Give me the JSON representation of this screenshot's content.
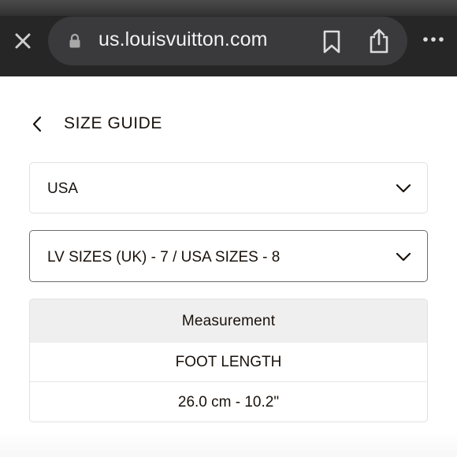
{
  "browser": {
    "url": "us.louisvuitton.com",
    "icons": [
      "close-icon",
      "lock-icon",
      "bookmark-icon",
      "share-icon",
      "more-icon"
    ]
  },
  "page": {
    "title": "SIZE GUIDE",
    "back_icon": "chevron-left-icon"
  },
  "country_select": {
    "value": "USA",
    "icon": "chevron-down-icon"
  },
  "size_select": {
    "value": "LV SIZES (UK) - 7 / USA SIZES - 8",
    "icon": "chevron-down-icon"
  },
  "table": {
    "header": "Measurement",
    "rows": [
      "FOOT LENGTH",
      "26.0 cm - 10.2\""
    ]
  },
  "colors": {
    "browser_bar": "#262626",
    "url_pill": "#3a3a3c",
    "text": "#19110b",
    "table_header_bg": "#efefef"
  }
}
